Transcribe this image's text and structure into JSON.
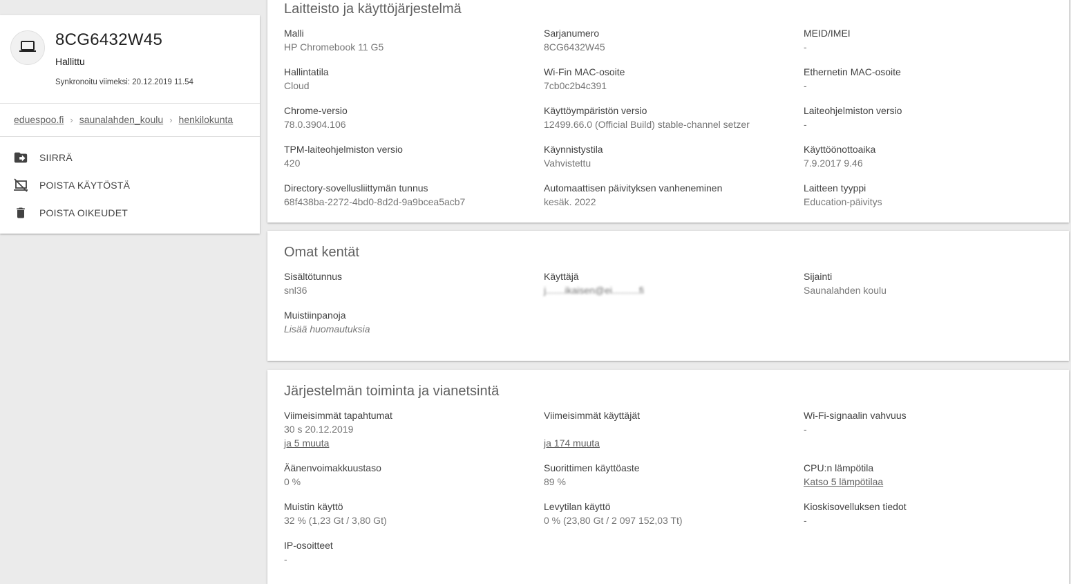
{
  "device": {
    "name": "8CG6432W45",
    "status": "Hallittu",
    "sync": "Synkronoitu viimeksi: 20.12.2019 11.54"
  },
  "breadcrumb": [
    "eduespoo.fi",
    "saunalahden_koulu",
    "henkilokunta"
  ],
  "actions": [
    {
      "label": "SIIRRÄ",
      "icon": "move-folder-icon"
    },
    {
      "label": "POISTA KÄYTÖSTÄ",
      "icon": "laptop-off-icon"
    },
    {
      "label": "POISTA OIKEUDET",
      "icon": "trash-icon"
    }
  ],
  "hardware": {
    "title": "Laitteisto ja käyttöjärjestelmä",
    "fields": [
      {
        "label": "Malli",
        "value": "HP Chromebook 11 G5"
      },
      {
        "label": "Sarjanumero",
        "value": "8CG6432W45"
      },
      {
        "label": "MEID/IMEI",
        "value": "-"
      },
      {
        "label": "Hallintatila",
        "value": "Cloud"
      },
      {
        "label": "Wi-Fin MAC-osoite",
        "value": "7cb0c2b4c391"
      },
      {
        "label": "Ethernetin MAC-osoite",
        "value": "-"
      },
      {
        "label": "Chrome-versio",
        "value": "78.0.3904.106"
      },
      {
        "label": "Käyttöympäristön versio",
        "value": "12499.66.0 (Official Build) stable-channel setzer"
      },
      {
        "label": "Laiteohjelmiston versio",
        "value": "-"
      },
      {
        "label": "TPM-laiteohjelmiston versio",
        "value": "420"
      },
      {
        "label": "Käynnistystila",
        "value": "Vahvistettu"
      },
      {
        "label": "Käyttöönottoaika",
        "value": "7.9.2017 9.46"
      },
      {
        "label": "Directory-sovellusliittymän tunnus",
        "value": "68f438ba-2272-4bd0-8d2d-9a9bcea5acb7"
      },
      {
        "label": "Automaattisen päivityksen vanheneminen",
        "value": "kesäk. 2022"
      },
      {
        "label": "Laitteen tyyppi",
        "value": "Education-päivitys"
      }
    ]
  },
  "custom": {
    "title": "Omat kentät",
    "fields": [
      {
        "label": "Sisältötunnus",
        "value": "snl36"
      },
      {
        "label": "Käyttäjä",
        "value": "j.......ikaisen@ei..........fi"
      },
      {
        "label": "Sijainti",
        "value": "Saunalahden koulu"
      },
      {
        "label": "Muistiinpanoja",
        "value": "Lisää huomautuksia"
      }
    ]
  },
  "diagnostics": {
    "title": "Järjestelmän toiminta ja vianetsintä",
    "recent_events": {
      "label": "Viimeisimmät tapahtumat",
      "value": "30 s 20.12.2019",
      "link": "ja 5 muuta"
    },
    "recent_users": {
      "label": "Viimeisimmät käyttäjät",
      "value": "",
      "link": "ja 174 muuta"
    },
    "wifi": {
      "label": "Wi-Fi-signaalin vahvuus",
      "value": "-"
    },
    "volume": {
      "label": "Äänenvoimakkuustaso",
      "value": "0 %"
    },
    "cpu": {
      "label": "Suorittimen käyttöaste",
      "value": "89 %"
    },
    "cpu_temp": {
      "label": "CPU:n lämpötila",
      "link": "Katso 5 lämpötilaa"
    },
    "memory": {
      "label": "Muistin käyttö",
      "value": "32 % (1,23 Gt / 3,80 Gt)"
    },
    "disk": {
      "label": "Levytilan käyttö",
      "value": "0 % (23,80 Gt / 2 097 152,03 Tt)"
    },
    "kiosk": {
      "label": "Kioskisovelluksen tiedot",
      "value": "-"
    },
    "ip": {
      "label": "IP-osoitteet",
      "value": "-"
    }
  }
}
